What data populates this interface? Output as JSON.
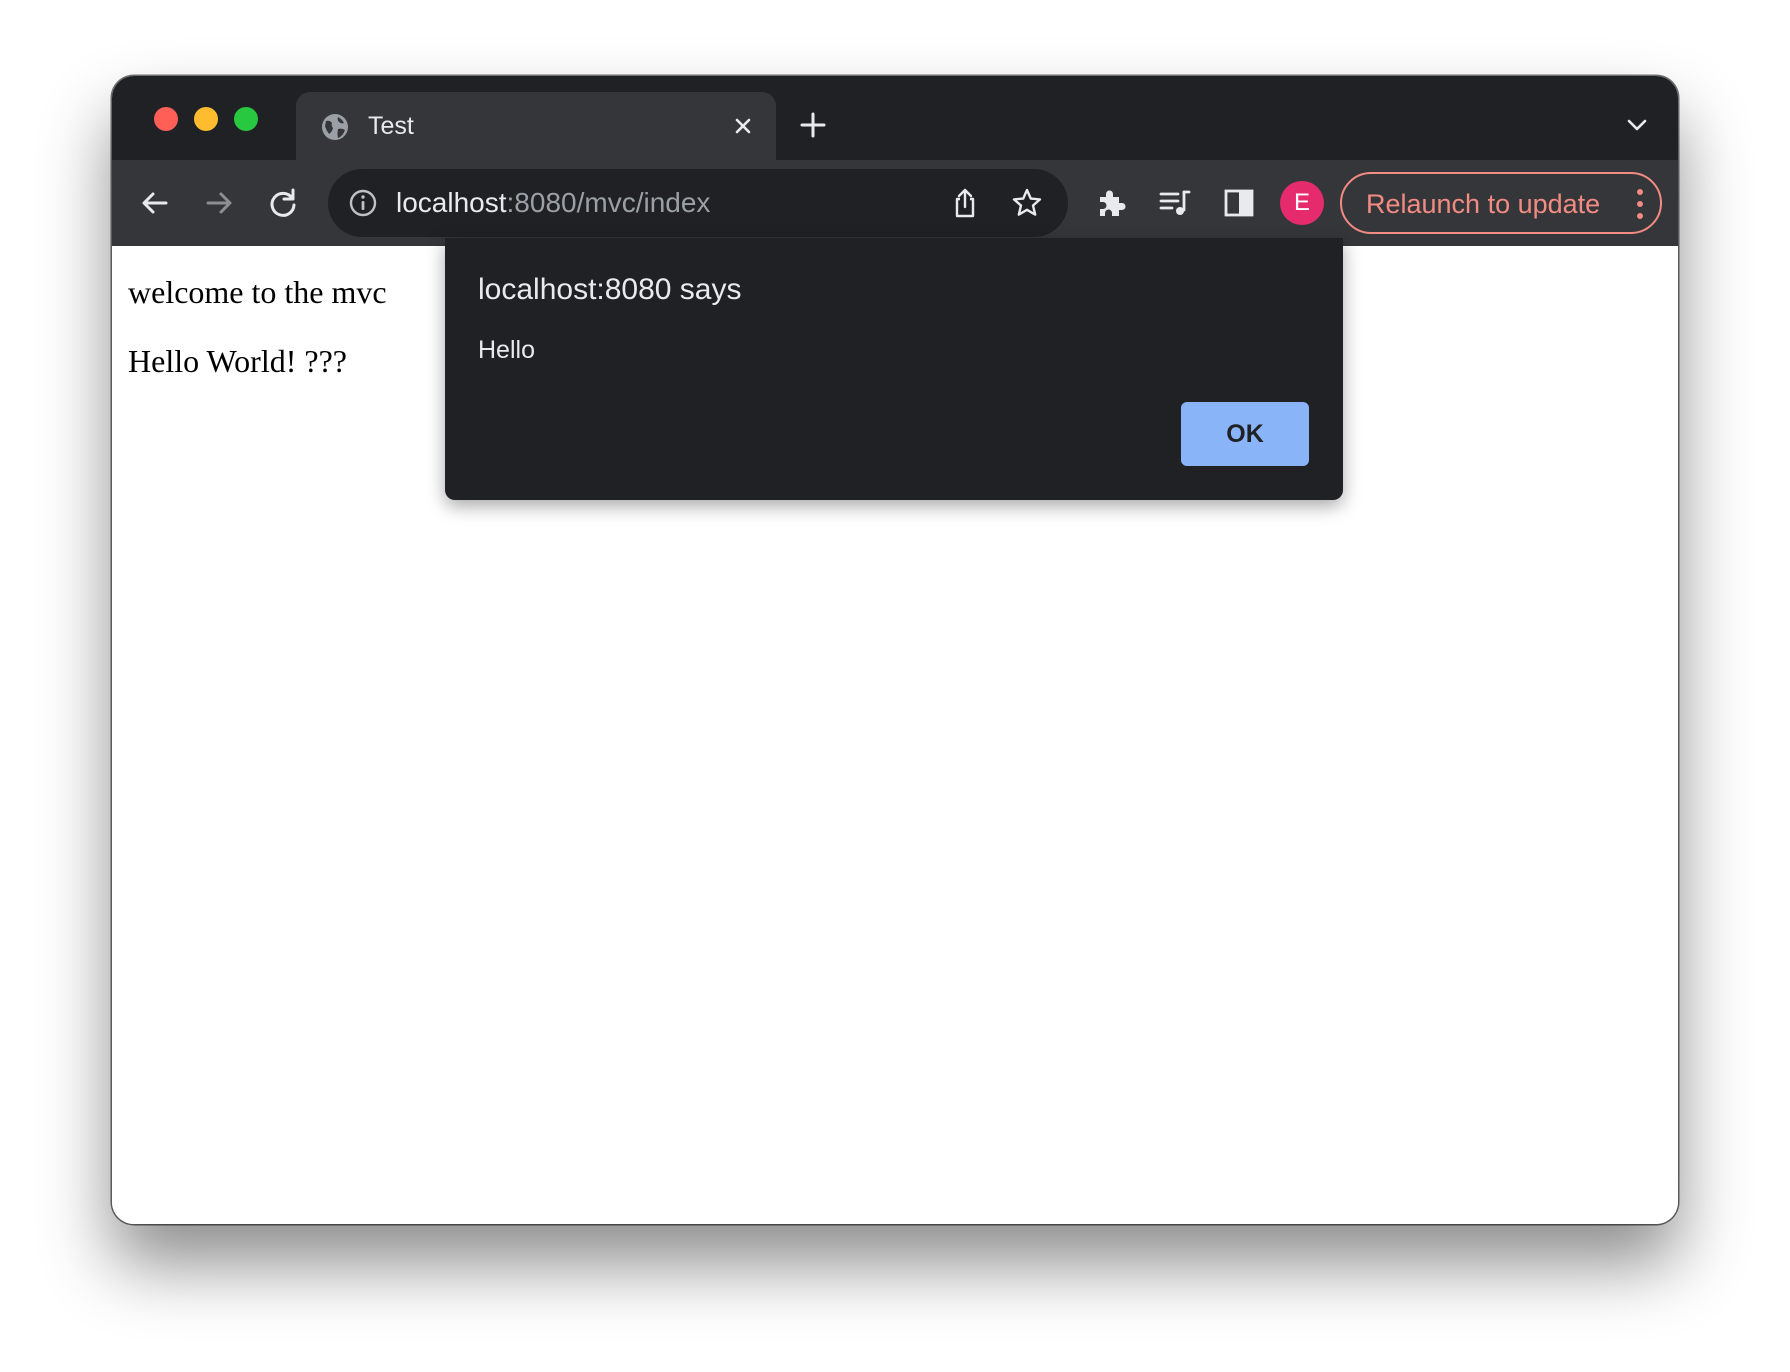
{
  "browser": {
    "tab": {
      "title": "Test",
      "icon": "globe-icon"
    },
    "toolbar": {
      "url_host": "localhost",
      "url_path": ":8080/mvc/index",
      "profile_initial": "E",
      "relaunch_label": "Relaunch to update"
    }
  },
  "page": {
    "line1": "welcome to the mvc",
    "line2": "Hello World! ???"
  },
  "dialog": {
    "title": "localhost:8080 says",
    "message": "Hello",
    "ok_label": "OK"
  },
  "colors": {
    "traffic_close": "#ff5f57",
    "traffic_minimize": "#febc2e",
    "traffic_zoom": "#28c840",
    "avatar": "#e52b6b",
    "relaunch_accent": "#f28b82",
    "dialog_button": "#8ab4f8"
  }
}
